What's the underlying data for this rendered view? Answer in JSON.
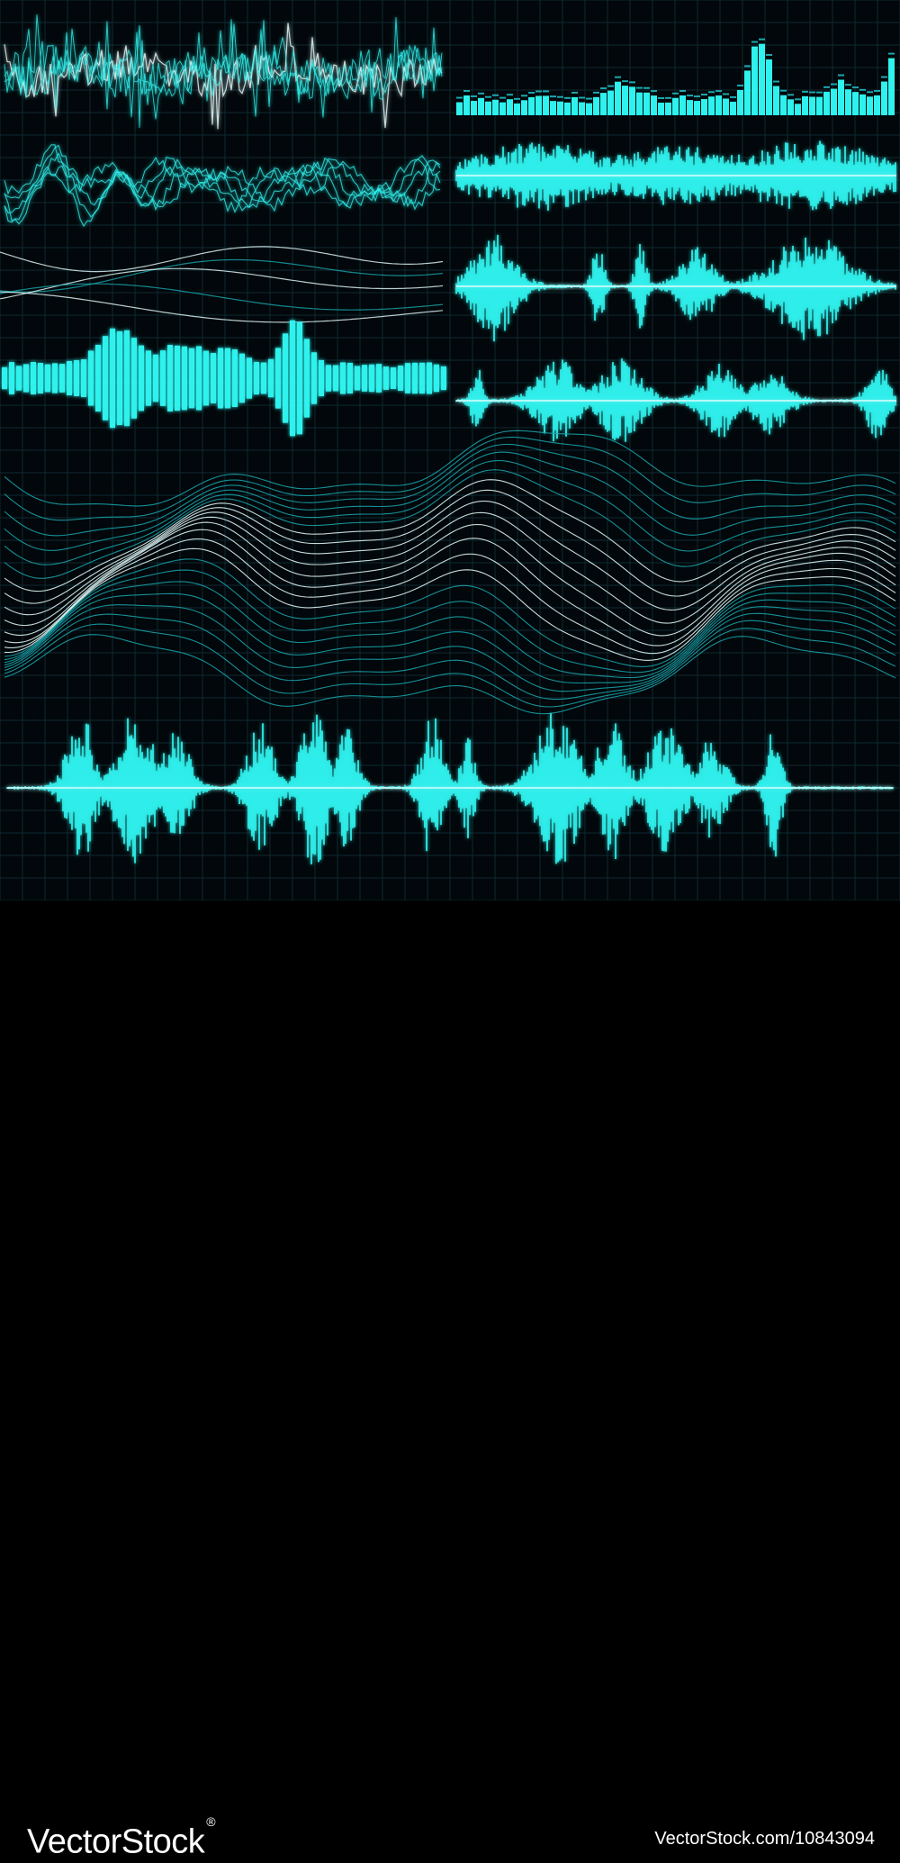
{
  "colors": {
    "background": "#01070a",
    "grid": "#0e2a33",
    "wave": "#2ff2ee",
    "wave_dim": "#1aa8b0",
    "highlight": "#e8ffff"
  },
  "footer": {
    "brand": "VectorStock",
    "registered_mark": "®",
    "image_id": "VectorStock.com/10843094"
  }
}
